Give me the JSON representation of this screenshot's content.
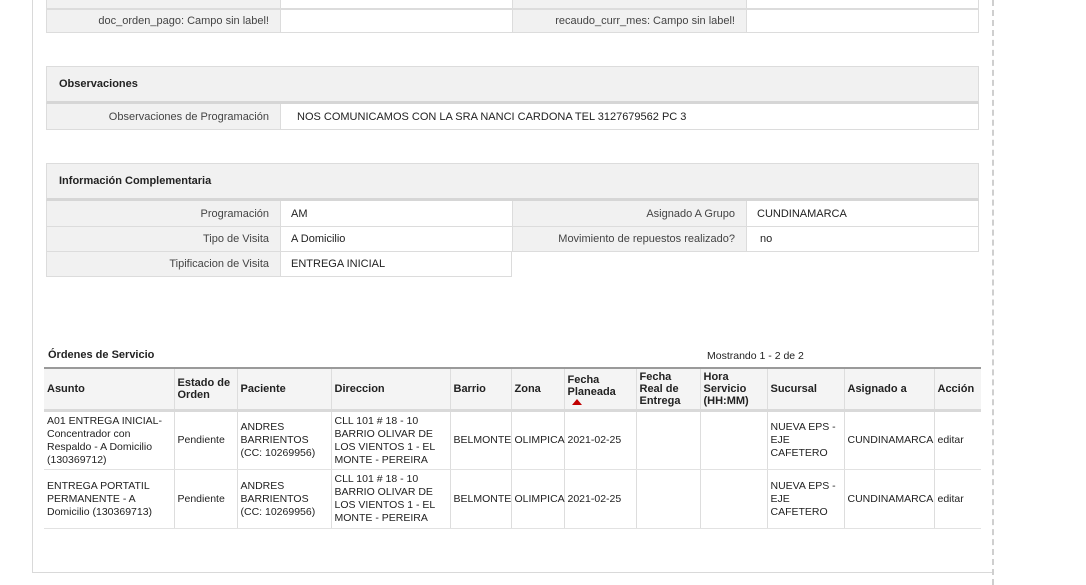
{
  "top_row": {
    "left_label": "doc_orden_pago: Campo sin label!",
    "left_value": "",
    "right_label": "recaudo_curr_mes: Campo sin label!",
    "right_value": ""
  },
  "observaciones": {
    "title": "Observaciones",
    "label": "Observaciones de Programación",
    "value": "NOS COMUNICAMOS CON LA SRA NANCI CARDONA TEL 3127679562 PC 3"
  },
  "info": {
    "title": "Información Complementaria",
    "rows": [
      {
        "label": "Programación",
        "value": "AM",
        "label2": "Asignado A Grupo",
        "value2": "CUNDINAMARCA"
      },
      {
        "label": "Tipo de Visita",
        "value": "A Domicilio",
        "label2": "Movimiento de repuestos realizado?",
        "value2": "no"
      },
      {
        "label": "Tipificacion de Visita",
        "value": "ENTREGA INICIAL"
      }
    ]
  },
  "orders": {
    "title": "Órdenes de Servicio",
    "count_text": "Mostrando 1 - 2 de 2",
    "headers": [
      "Asunto",
      "Estado de Orden",
      "Paciente",
      "Direccion",
      "Barrio",
      "Zona",
      "Fecha Planeada",
      "Fecha Real de Entrega",
      "Hora Servicio (HH:MM)",
      "Sucursal",
      "Asignado a",
      "Acción"
    ],
    "sorted_column": "Fecha Planeada",
    "sort_color": "#c00000",
    "rows": [
      {
        "asunto": "A01 ENTREGA INICIAL- Concentrador con Respaldo - A Domicilio (130369712)",
        "estado": "Pendiente",
        "paciente": "ANDRES BARRIENTOS (CC: 10269956)",
        "direccion": "CLL 101 # 18 - 10 BARRIO OLIVAR DE LOS VIENTOS 1 - EL MONTE - PEREIRA",
        "barrio": "BELMONTE",
        "zona": "OLIMPICA",
        "fecha_planeada": "2021-02-25",
        "fecha_real": "",
        "hora": "",
        "sucursal": "NUEVA EPS - EJE CAFETERO",
        "asignado": "CUNDINAMARCA",
        "accion": "editar"
      },
      {
        "asunto": "ENTREGA PORTATIL PERMANENTE - A Domicilio (130369713)",
        "estado": "Pendiente",
        "paciente": "ANDRES BARRIENTOS (CC: 10269956)",
        "direccion": "CLL 101 # 18 - 10 BARRIO OLIVAR DE LOS VIENTOS 1 - EL MONTE - PEREIRA",
        "barrio": "BELMONTE",
        "zona": "OLIMPICA",
        "fecha_planeada": "2021-02-25",
        "fecha_real": "",
        "hora": "",
        "sucursal": "NUEVA EPS - EJE CAFETERO",
        "asignado": "CUNDINAMARCA",
        "accion": "editar"
      }
    ]
  }
}
